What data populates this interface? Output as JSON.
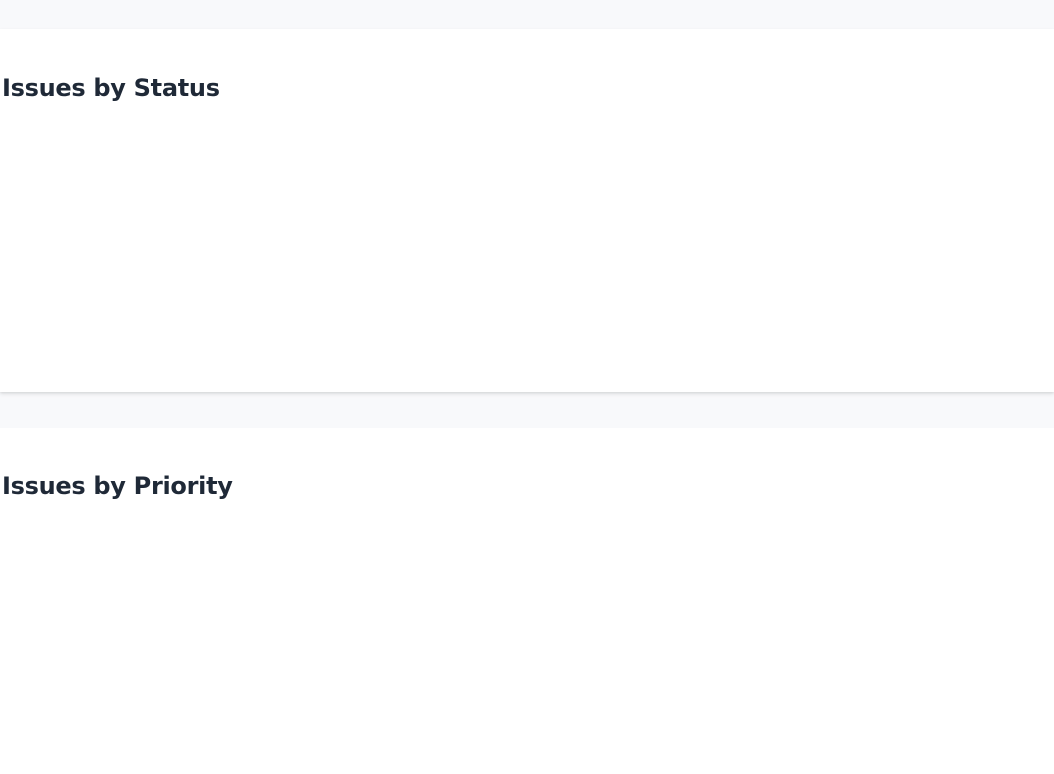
{
  "sections": {
    "status": {
      "title": "Issues by Status"
    },
    "priority": {
      "title": "Issues by Priority"
    }
  },
  "colors": {
    "page_background": "#f8f9fb",
    "card_background": "#ffffff",
    "title_text": "#1f2937"
  }
}
